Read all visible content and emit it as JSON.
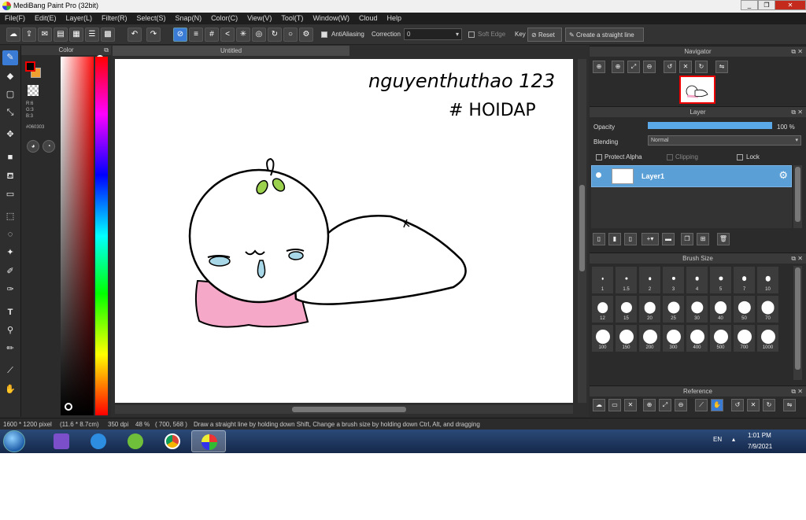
{
  "window": {
    "title": "MediBang Paint Pro (32bit)",
    "minimize": "_",
    "maximize": "❐",
    "close": "✕"
  },
  "menu": [
    "File(F)",
    "Edit(E)",
    "Layer(L)",
    "Filter(R)",
    "Select(S)",
    "Snap(N)",
    "Color(C)",
    "View(V)",
    "Tool(T)",
    "Window(W)",
    "Cloud",
    "Help"
  ],
  "toolbar": {
    "antialiasing": "AntiAliasing",
    "correction_label": "Correction",
    "correction_value": "0",
    "soft_edge": "Soft Edge",
    "key_label": "Key",
    "reset": "Reset",
    "straight_line": "Create a straight line"
  },
  "color_panel": {
    "title": "Color",
    "r": "R:6",
    "g": "G:3",
    "b": "B:3",
    "hex": "#060303",
    "fg_color": "#060303"
  },
  "document": {
    "tab_title": "Untitled"
  },
  "canvas_text": {
    "line1": "nguyenthuthao 123",
    "line2": "# HOIDAP"
  },
  "navigator": {
    "title": "Navigator"
  },
  "layer_panel": {
    "title": "Layer",
    "opacity_label": "Opacity",
    "opacity_value": "100 %",
    "opacity_fraction": 1.0,
    "blending_label": "Blending",
    "blending_value": "Normal",
    "protect_alpha": "Protect Alpha",
    "clipping": "Clipping",
    "lock": "Lock",
    "layers": [
      {
        "name": "Layer1"
      }
    ]
  },
  "brush_size": {
    "title": "Brush Size",
    "sizes": [
      "1",
      "1.5",
      "2",
      "3",
      "4",
      "5",
      "7",
      "10",
      "12",
      "15",
      "20",
      "25",
      "30",
      "40",
      "50",
      "70",
      "100",
      "150",
      "200",
      "300",
      "400",
      "500",
      "700",
      "1000"
    ]
  },
  "reference": {
    "title": "Reference"
  },
  "status": {
    "size": "1600 * 1200 pixel",
    "physical": "(11.6 * 8.7cm)",
    "dpi": "350 dpi",
    "zoom": "48 %",
    "cursor": "( 700, 568 )",
    "hint": "Draw a straight line by holding down Shift, Change a brush size by holding down Ctrl, Alt, and dragging"
  },
  "taskbar": {
    "lang": "EN",
    "time": "1:01 PM",
    "date": "7/9/2021"
  }
}
